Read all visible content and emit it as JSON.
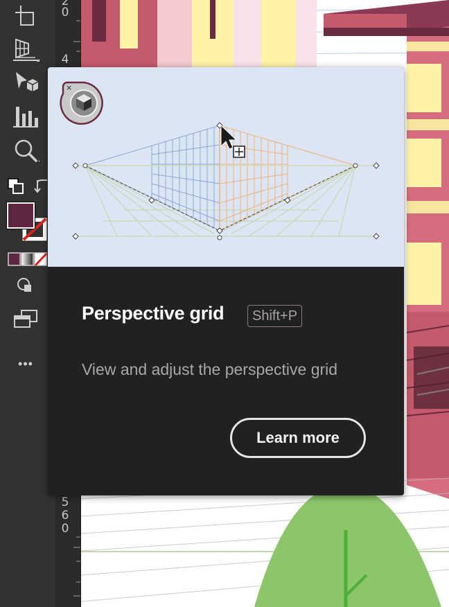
{
  "toolbar": {
    "tools": [
      {
        "icon": "artboard-icon"
      },
      {
        "icon": "perspective-grid-icon"
      },
      {
        "icon": "symbol-sprayer-icon"
      },
      {
        "icon": "column-graph-icon"
      },
      {
        "icon": "zoom-icon"
      },
      {
        "icon": "default-fill-stroke-icon"
      },
      {
        "icon": "swap-fill-stroke-icon"
      },
      {
        "icon": "fill-swatch-icon"
      },
      {
        "icon": "stroke-swatch-icon"
      },
      {
        "icon": "color-mode-icon"
      },
      {
        "icon": "draw-mode-icon"
      },
      {
        "icon": "screen-mode-icon"
      },
      {
        "icon": "more-tools-icon"
      }
    ],
    "fill_color": "#5e2640",
    "more_label": "•••"
  },
  "ruler": {
    "top_digits": [
      "2",
      "0"
    ],
    "mid_digit": "4",
    "bottom_digits": [
      "5",
      "6",
      "0"
    ]
  },
  "tooltip": {
    "title": "Perspective grid",
    "shortcut": "Shift+P",
    "description": "View and adjust the perspective grid",
    "learn_more_label": "Learn more",
    "close_glyph": "×"
  },
  "colors": {
    "toolbar_bg": "#323232",
    "tooltip_bg": "#212121",
    "illustration_bg": "#dbe5f3",
    "building": "#c45a6c",
    "building_dark": "#6a2a40",
    "window_yellow": "#fff3a6",
    "tree": "#8cc56a"
  }
}
